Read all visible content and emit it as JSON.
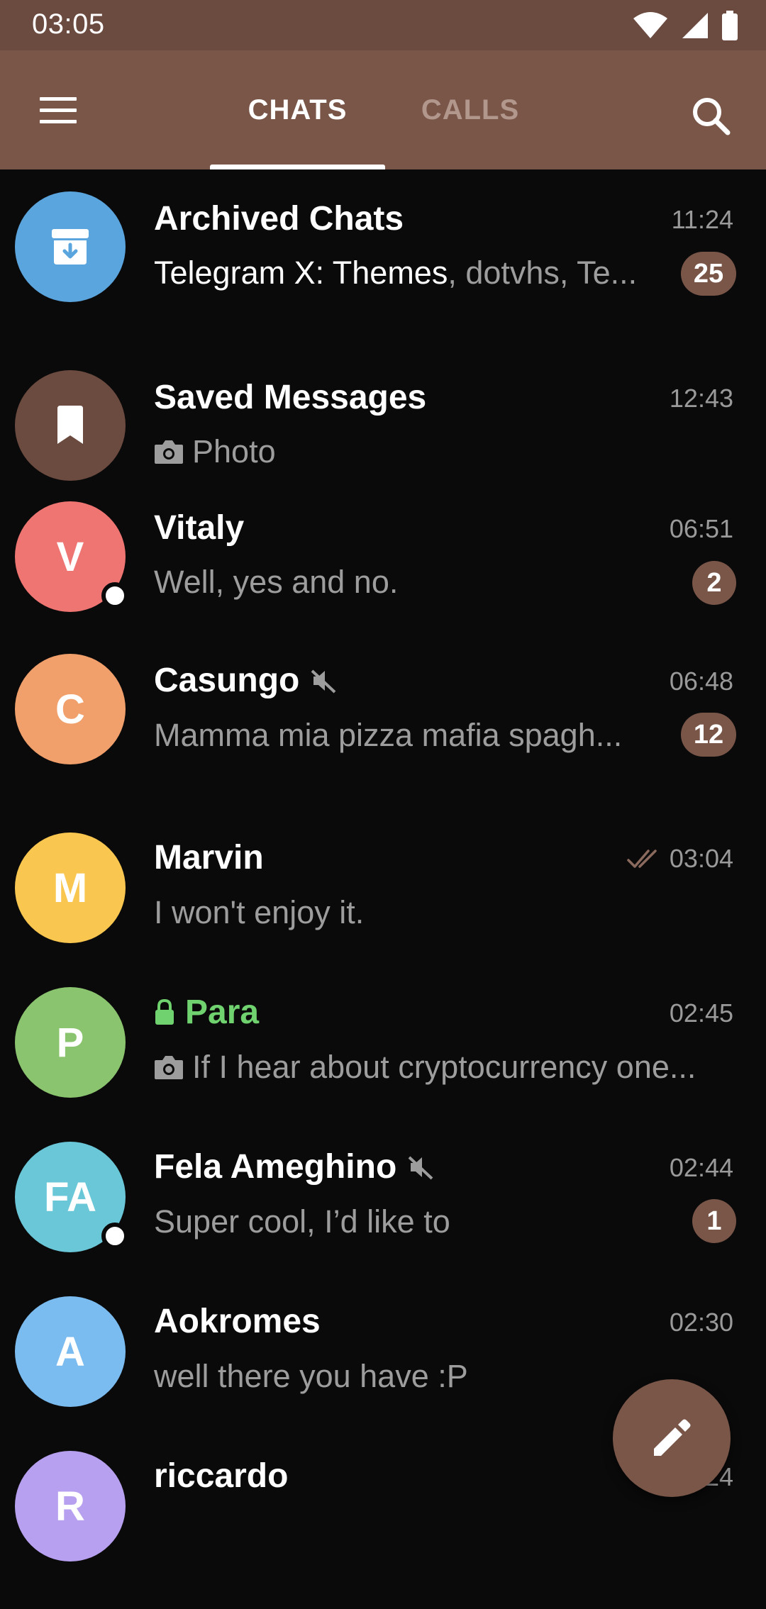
{
  "status_bar": {
    "time": "03:05"
  },
  "app_bar": {
    "tabs": [
      {
        "label": "CHATS",
        "active": true
      },
      {
        "label": "CALLS",
        "active": false
      }
    ]
  },
  "colors": {
    "accent": "#7a5649",
    "status_bar": "#6b4a3f",
    "background": "#0b0a0b",
    "secret_chat_green": "#6fd26f"
  },
  "chats": [
    {
      "name": "Archived Chats",
      "time": "11:24",
      "message_highlight": "Telegram X: Themes",
      "message": ", dotvhs, Te...",
      "badge": "25",
      "avatar_color": "#5aa5de",
      "avatar_icon": "archive-icon"
    },
    {
      "name": "Saved Messages",
      "time": "12:43",
      "message": "Photo",
      "message_icon": "camera-icon",
      "avatar_color": "#6b4a3f",
      "avatar_icon": "bookmark-icon"
    },
    {
      "name": "Vitaly",
      "initials": "V",
      "time": "06:51",
      "message": "Well, yes and no.",
      "badge": "2",
      "avatar_color": "#ef7572",
      "online": true
    },
    {
      "name": "Casungo",
      "initials": "C",
      "time": "06:48",
      "message": "Mamma mia pizza mafia spagh...",
      "badge": "12",
      "avatar_color": "#f2a06b",
      "muted": true
    },
    {
      "name": "Marvin",
      "initials": "M",
      "time": "03:04",
      "message": "I won't enjoy it.",
      "avatar_color": "#f9c74f",
      "read_checks": true
    },
    {
      "name": "Para",
      "initials": "P",
      "time": "02:45",
      "message": "If I hear about cryptocurrency one...",
      "message_icon": "camera-icon",
      "avatar_color": "#8bc46e",
      "secret": true
    },
    {
      "name": "Fela Ameghino",
      "initials": "FA",
      "time": "02:44",
      "message": "Super cool, I’d like to",
      "badge": "1",
      "avatar_color": "#6ac7d8",
      "muted": true,
      "online": true
    },
    {
      "name": "Aokromes",
      "initials": "A",
      "time": "02:30",
      "message": "well there you have :P",
      "avatar_color": "#7bbcf0"
    },
    {
      "name": "riccardo",
      "initials": "R",
      "time": "02:24",
      "message": "",
      "avatar_color": "#b7a0f0"
    }
  ]
}
